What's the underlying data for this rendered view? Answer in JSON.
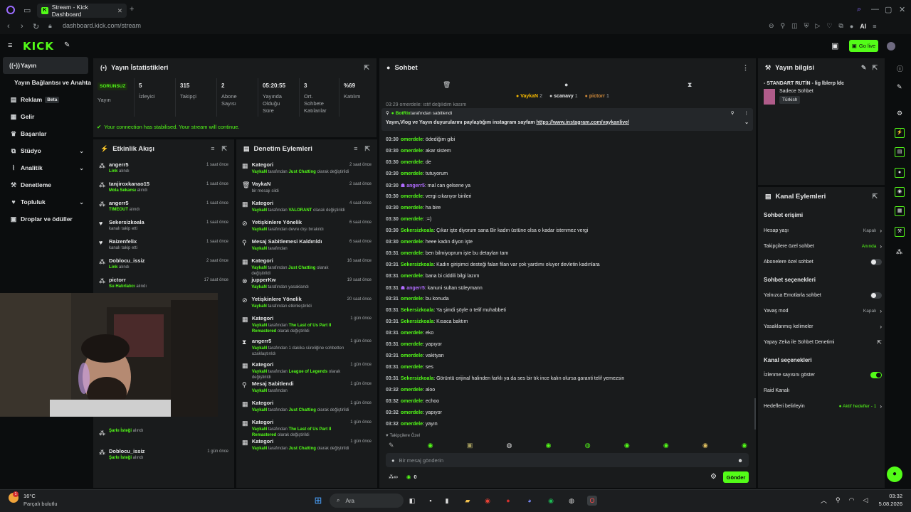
{
  "browser": {
    "tab_title": "Stream - Kick Dashboard",
    "url": "dashboard.kick.com/stream",
    "ai_label": "AI"
  },
  "dashboard": {
    "logo": "KICK",
    "go_live": "Go live"
  },
  "sidebar": {
    "items": [
      {
        "label": "Yayın",
        "icon": "broadcast-icon"
      },
      {
        "label": "Yayın Bağlantısı ve Anahtarı",
        "icon": "key-icon"
      },
      {
        "label": "Reklam",
        "icon": "ad-icon",
        "badge": "Beta"
      },
      {
        "label": "Gelir",
        "icon": "money-icon"
      },
      {
        "label": "Başarılar",
        "icon": "trophy-icon"
      },
      {
        "label": "Stüdyo",
        "icon": "studio-icon"
      },
      {
        "label": "Analitik",
        "icon": "chart-icon"
      },
      {
        "label": "Denetleme",
        "icon": "wrench-icon"
      },
      {
        "label": "Topluluk",
        "icon": "community-icon"
      },
      {
        "label": "Droplar ve ödüller",
        "icon": "gift-icon"
      }
    ]
  },
  "stats": {
    "title": "Yayın İstatistikleri",
    "status_badge": "SORUNSUZ",
    "status_label": "Yayın",
    "items": [
      {
        "value": "5",
        "label": "İzleyici"
      },
      {
        "value": "315",
        "label": "Takipçi"
      },
      {
        "value": "2",
        "label": "Abone Sayısı"
      },
      {
        "value": "05:20:55",
        "label": "Yayında Olduğu Süre"
      },
      {
        "value": "3",
        "label": "Ort. Sohbete Katılanlar"
      },
      {
        "value": "%69",
        "label": "Katılım"
      }
    ],
    "ok_message": "Your connection has stabilised. Your stream will continue."
  },
  "activity": {
    "title": "Etkinlik Akışı",
    "items": [
      {
        "name": "angerr5",
        "sub": "Link",
        "sub_rest": " alındı",
        "time": "1 saat önce"
      },
      {
        "name": "tanjiroxkanao15",
        "sub": "Mola Sekansı",
        "sub_rest": " alındı",
        "time": "1 saat önce"
      },
      {
        "name": "angerr5",
        "sub": "TIMEOUT",
        "sub_rest": " alındı",
        "time": "1 saat önce"
      },
      {
        "name": "Sekersizkoala",
        "sub": "",
        "sub_rest": "kanalı takip etti",
        "time": "1 saat önce"
      },
      {
        "name": "Raizenfelix",
        "sub": "",
        "sub_rest": "kanalı takip etti",
        "time": "1 saat önce"
      },
      {
        "name": "Doblocu_issiz",
        "sub": "Link",
        "sub_rest": " alındı",
        "time": "2 saat önce"
      },
      {
        "name": "pictorr",
        "sub": "Su Hatırlatıcı",
        "sub_rest": " alındı",
        "time": "17 saat önce"
      },
      {
        "name": "",
        "sub": "Şarkı İsteği",
        "sub_rest": " alındı",
        "time": ""
      },
      {
        "name": "Doblocu_issiz",
        "sub": "Şarkı İsteği",
        "sub_rest": " alındı",
        "time": "1 gün önce"
      }
    ]
  },
  "moderation": {
    "title": "Denetim Eylemleri",
    "items": [
      {
        "title": "Kategori",
        "user": "VaykaN",
        "mid": " tarafından ",
        "target": "Just Chatting",
        "end": " olarak değiştirildi",
        "time": "2 saat önce"
      },
      {
        "title": "VaykaN",
        "user": "",
        "mid": "bir mesajı sildi",
        "target": "",
        "end": "",
        "time": "2 saat önce"
      },
      {
        "title": "Kategori",
        "user": "VaykaN",
        "mid": " tarafından ",
        "target": "VALORANT",
        "end": " olarak değiştirildi",
        "time": "4 saat önce"
      },
      {
        "title": "Yetişkinlere Yönelik",
        "user": "VaykaN",
        "mid": " tarafından devre dışı bırakıldı",
        "target": "",
        "end": "",
        "time": "6 saat önce"
      },
      {
        "title": "Mesaj Sabitlemesi Kaldırıldı",
        "user": "VaykaN",
        "mid": " tarafından",
        "target": "",
        "end": "",
        "time": "6 saat önce"
      },
      {
        "title": "Kategori",
        "user": "VaykaN",
        "mid": " tarafından ",
        "target": "Just Chatting",
        "end": " olarak değiştirildi",
        "time": "16 saat önce"
      },
      {
        "title": "jupperKw",
        "user": "VaykaN",
        "mid": " tarafından yasaklandı",
        "target": "",
        "end": "",
        "time": "19 saat önce"
      },
      {
        "title": "Yetişkinlere Yönelik",
        "user": "VaykaN",
        "mid": " tarafından etkinleştirildi",
        "target": "",
        "end": "",
        "time": "20 saat önce"
      },
      {
        "title": "Kategori",
        "user": "VaykaN",
        "mid": " tarafından ",
        "target": "The Last of Us Part II Remastered",
        "end": " olarak değiştirildi",
        "time": "1 gün önce"
      },
      {
        "title": "angerr5",
        "user": "VaykaN",
        "mid": " tarafından 1 dakika süreliğine sohbetten uzaklaştırıldı",
        "target": "",
        "end": "",
        "time": "1 gün önce"
      },
      {
        "title": "Kategori",
        "user": "VaykaN",
        "mid": " tarafından ",
        "target": "League of Legends",
        "end": " olarak değiştirildi",
        "time": "1 gün önce"
      },
      {
        "title": "Mesaj Sabitlendi",
        "user": "VaykaN",
        "mid": " tarafından",
        "target": "",
        "end": "",
        "time": "1 gün önce"
      },
      {
        "title": "Kategori",
        "user": "VaykaN",
        "mid": " tarafından ",
        "target": "Just Chatting",
        "end": " olarak değiştirildi",
        "time": "1 gün önce"
      },
      {
        "title": "Kategori",
        "user": "VaykaN",
        "mid": " tarafından ",
        "target": "The Last of Us Part II Remastered",
        "end": " olarak değiştirildi",
        "time": "1 gün önce"
      },
      {
        "title": "Kategori",
        "user": "VaykaN",
        "mid": " tarafından ",
        "target": "Just Chatting",
        "end": " olarak değiştirildi",
        "time": "1 gün önce"
      }
    ]
  },
  "chat": {
    "title": "Sohbet",
    "top_users": [
      {
        "name": "VaykaN",
        "count": "2"
      },
      {
        "name": "scanavy",
        "count": "1"
      },
      {
        "name": "pictorr",
        "count": "1"
      }
    ],
    "top_partial": "03:29 omerdele: istif değilidim kasım",
    "pinned_by": "BotRix",
    "pinned_by_rest": " tarafından sabitlendi",
    "pinned_text": "Yayın,Vlog ve Yayın duyurularını paylaştığım instagram sayfam ",
    "pinned_link": "https://www.instagram.com/vaykanlive/",
    "messages": [
      {
        "time": "03:30",
        "user": "omerdele",
        "text": "ödediğim gibi",
        "alt": false
      },
      {
        "time": "03:30",
        "user": "omerdele",
        "text": "akar sistem",
        "alt": false
      },
      {
        "time": "03:30",
        "user": "omerdele",
        "text": "de",
        "alt": false
      },
      {
        "time": "03:30",
        "user": "omerdele",
        "text": "tutuyorum",
        "alt": false
      },
      {
        "time": "03:30",
        "user": "angerr5",
        "text": "mal can gelsene ya",
        "alt": true
      },
      {
        "time": "03:30",
        "user": "omerdele",
        "text": "vergi cıkarıyor birileri",
        "alt": false
      },
      {
        "time": "03:30",
        "user": "omerdele",
        "text": "ha bire",
        "alt": false
      },
      {
        "time": "03:30",
        "user": "omerdele",
        "text": ":=)",
        "alt": false
      },
      {
        "time": "03:30",
        "user": "Sekersizkoala",
        "text": "Çıkar işte diyorum sana Bir kadın üstüne olsa o kadar istenmez vergi",
        "alt": false
      },
      {
        "time": "03:30",
        "user": "omerdele",
        "text": "heee kadın diyon işte",
        "alt": false
      },
      {
        "time": "03:31",
        "user": "omerdele",
        "text": "ben bilmiyoprum işte bu detayları tam",
        "alt": false
      },
      {
        "time": "03:31",
        "user": "Sekersizkoala",
        "text": "Kadın girişimci desteği falan filan var çok yardımı oluyor devletin kadınlara",
        "alt": false
      },
      {
        "time": "03:31",
        "user": "omerdele",
        "text": "bana bi ciddili bilgi lazım",
        "alt": false
      },
      {
        "time": "03:31",
        "user": "angerr5",
        "text": "kanuni sultan süleymann",
        "alt": true
      },
      {
        "time": "03:31",
        "user": "omerdele",
        "text": "bu konuda",
        "alt": false
      },
      {
        "time": "03:31",
        "user": "Sekersizkoala",
        "text": "Ya şimdi şöyle o telif muhabbeti",
        "alt": false
      },
      {
        "time": "03:31",
        "user": "Sekersizkoala",
        "text": "Kısaca baktım",
        "alt": false
      },
      {
        "time": "03:31",
        "user": "omerdele",
        "text": "eko",
        "alt": false
      },
      {
        "time": "03:31",
        "user": "omerdele",
        "text": "yapıyor",
        "alt": false
      },
      {
        "time": "03:31",
        "user": "omerdele",
        "text": "vakityan",
        "alt": false
      },
      {
        "time": "03:31",
        "user": "omerdele",
        "text": "ses",
        "alt": false
      },
      {
        "time": "03:31",
        "user": "Sekersizkoala",
        "text": "Görüntü orijinal halinden farklı ya da ses bir tık ince kalın olursa garanti telif yemezsin",
        "alt": false
      },
      {
        "time": "03:32",
        "user": "omerdele",
        "text": "aloo",
        "alt": false
      },
      {
        "time": "03:32",
        "user": "omerdele",
        "text": "echoo",
        "alt": false
      },
      {
        "time": "03:32",
        "user": "omerdele",
        "text": "yapıyor",
        "alt": false
      },
      {
        "time": "03:32",
        "user": "omerdele",
        "text": "yayın",
        "alt": false
      }
    ],
    "followers_only": "Takipçilere Özel",
    "input_placeholder": "Bir mesaj gönderin",
    "points": "0",
    "send": "Gönder"
  },
  "stream_info": {
    "title": "Yayın bilgisi",
    "stream_title": "- STANDART RUTİN - lig lblerp ldc",
    "category": "Sadece Sohbet",
    "tag": "Türkish"
  },
  "channel_actions": {
    "title": "Kanal Eylemleri",
    "sections": [
      {
        "heading": "Sohbet erişimi",
        "rows": [
          {
            "label": "Hesap yaşı",
            "value": "Kapalı",
            "kind": "arrow"
          },
          {
            "label": "Takipçilere özel sohbet",
            "value": "Anında",
            "kind": "arrow",
            "green": true
          },
          {
            "label": "Abonelere özel sohbet",
            "value": "",
            "kind": "toggle-off"
          }
        ]
      },
      {
        "heading": "Sohbet seçenekleri",
        "rows": [
          {
            "label": "Yalnızca Emotlarla sohbet",
            "value": "",
            "kind": "toggle-off"
          },
          {
            "label": "Yavaş mod",
            "value": "Kapalı",
            "kind": "arrow"
          },
          {
            "label": "Yasaklanmış kelimeler",
            "value": "",
            "kind": "arrow"
          },
          {
            "label": "Yapay Zeka ile Sohbet Denetimi",
            "value": "",
            "kind": "ext"
          }
        ]
      },
      {
        "heading": "Kanal seçenekleri",
        "rows": [
          {
            "label": "İzlenme sayısını göster",
            "value": "",
            "kind": "toggle-on"
          },
          {
            "label": "Raid Kanalı",
            "value": "",
            "kind": "none"
          },
          {
            "label": "Hedefleri belirleyin",
            "value": "● Aktif hedefler - 1",
            "kind": "arrow",
            "green": true
          }
        ]
      }
    ]
  },
  "taskbar": {
    "weather_temp": "16°C",
    "weather_desc": "Parçalı bulutlu",
    "search": "Ara",
    "time": "03:32",
    "date": "5.08.2026"
  },
  "colors": {
    "accent": "#53fc18",
    "panel": "#191b1c",
    "bg": "#0b0d0e",
    "alt_user": "#b16cff"
  }
}
